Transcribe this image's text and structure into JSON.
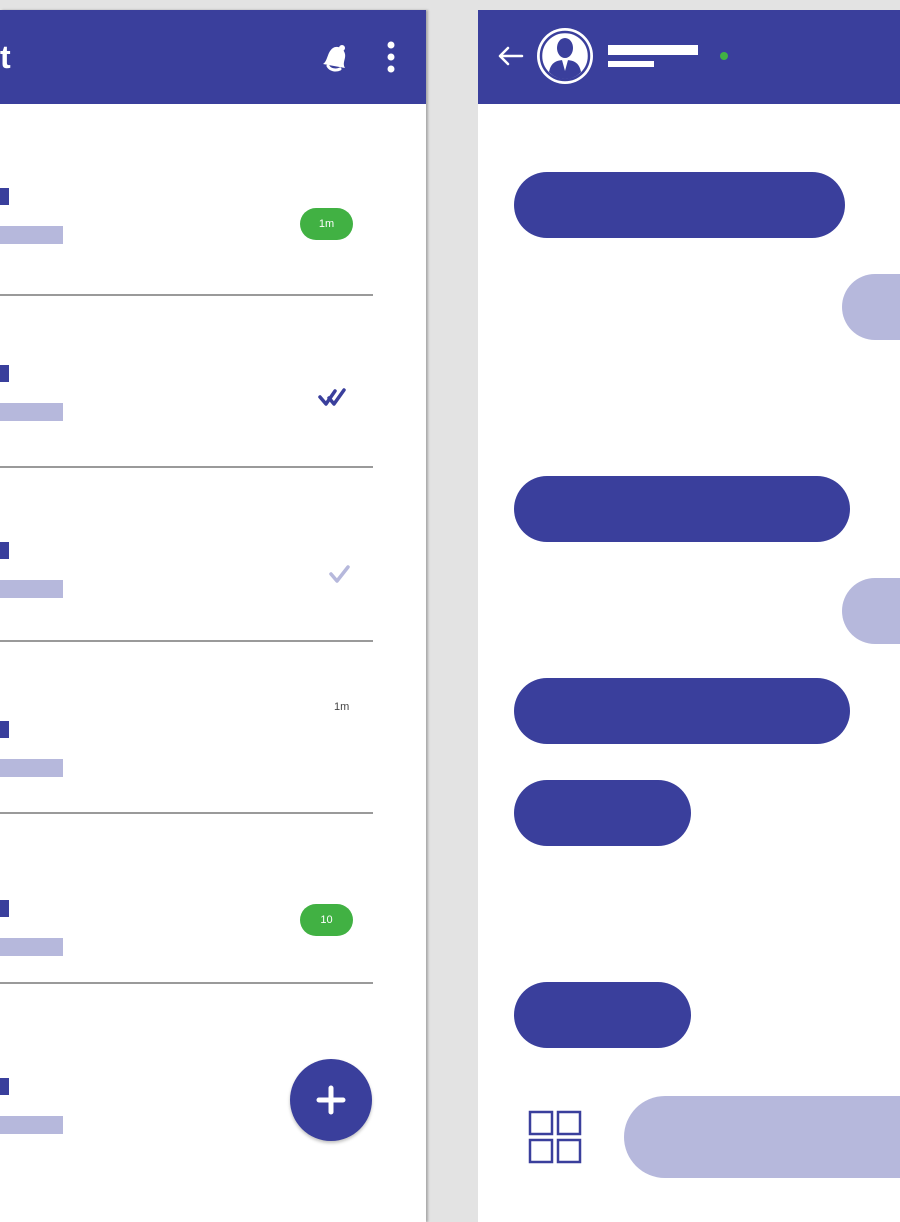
{
  "chat_list": {
    "header": {
      "title_visible_fragment": "t",
      "bell_icon": "bell-icon",
      "menu_icon": "kebab-menu-icon"
    },
    "rows": [
      {
        "status": "badge",
        "badge_text": "1m"
      },
      {
        "status": "double-check",
        "icon": "double-check-icon"
      },
      {
        "status": "single-check",
        "icon": "single-check-icon"
      },
      {
        "status": "time",
        "time_text": "1m"
      },
      {
        "status": "badge",
        "badge_text": "10"
      },
      {
        "status": "none"
      }
    ],
    "fab_icon": "plus-icon"
  },
  "conversation": {
    "header": {
      "back_icon": "back-arrow-icon",
      "avatar_icon": "user-avatar-icon",
      "online": true
    },
    "messages": [
      {
        "direction": "incoming"
      },
      {
        "direction": "outgoing"
      },
      {
        "direction": "incoming"
      },
      {
        "direction": "outgoing"
      },
      {
        "direction": "incoming"
      },
      {
        "direction": "incoming"
      },
      {
        "direction": "incoming"
      }
    ],
    "composer": {
      "attach_icon": "grid-icon",
      "placeholder": ""
    }
  },
  "colors": {
    "primary": "#3a3f9c",
    "primary_light": "#b6b8dc",
    "badge_green": "#41b143",
    "background": "#ffffff",
    "gutter": "#e3e3e3"
  }
}
